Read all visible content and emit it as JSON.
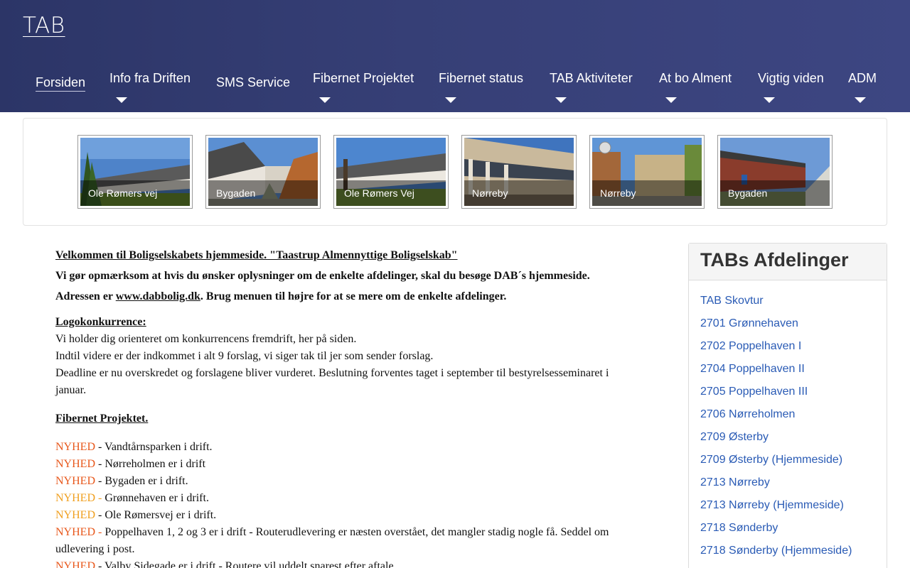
{
  "site": {
    "title": "TAB"
  },
  "nav": {
    "items": [
      {
        "label": "Forsiden",
        "active": true,
        "has_dropdown": false
      },
      {
        "label": "Info fra Driften",
        "has_dropdown": true
      },
      {
        "label": "SMS Service",
        "has_dropdown": false
      },
      {
        "label": "Fibernet Projektet",
        "has_dropdown": true
      },
      {
        "label": "Fibernet status",
        "has_dropdown": true
      },
      {
        "label": "TAB Aktiviteter",
        "has_dropdown": true
      },
      {
        "label": "At bo Alment",
        "has_dropdown": true
      },
      {
        "label": "Vigtig viden",
        "has_dropdown": true
      },
      {
        "label": "ADM",
        "has_dropdown": true
      }
    ]
  },
  "gallery": {
    "items": [
      {
        "caption": "Ole Rømers vej"
      },
      {
        "caption": "Bygaden"
      },
      {
        "caption": "Ole Rømers Vej"
      },
      {
        "caption": "Nørreby"
      },
      {
        "caption": "Nørreby"
      },
      {
        "caption": "Bygaden"
      }
    ]
  },
  "content": {
    "welcome": "Velkommen til Boligselskabets hjemmeside.  \"Taastrup Almennyttige Boligselskab\"",
    "notice_1": "Vi gør opmærksom at hvis du ønsker oplysninger om de enkelte afdelinger, skal du besøge DAB´s hjemmeside. Adressen er ",
    "notice_link": "www.dabbolig.dk",
    "notice_2": ". Brug menuen til højre for at se mere om de enkelte afdelinger.",
    "logo_heading": "Logokonkurrence:",
    "logo_p1": "Vi holder dig orienteret om konkurrencens fremdrift, her på siden.",
    "logo_p2": "Indtil videre er der indkommet i alt 9 forslag, vi siger tak til jer som sender forslag.",
    "logo_p3": "Deadline er nu overskredet og forslagene bliver vurderet. Beslutning forventes taget i september til bestyrelsesseminaret i januar.",
    "fiber_heading": "Fibernet Projektet.",
    "news": [
      {
        "tag": "NYHED",
        "text": " - Vandtårnsparken i drift."
      },
      {
        "tag": "NYHED",
        "text": " - Nørreholmen er i drift"
      },
      {
        "tag": "NYHED",
        "text": " - Bygaden er i drift."
      },
      {
        "tag": "NYHED - ",
        "text": "Grønnehaven er i drift."
      },
      {
        "tag": "NYHED",
        "text": " - Ole Rømersvej er i drift."
      },
      {
        "tag": "NYHED - ",
        "text": "Poppelhaven 1, 2 og 3 er i drift - Routerudlevering er næsten overstået, det mangler stadig nogle få. Seddel om udlevering i post."
      },
      {
        "tag": "NYHED",
        "text": " - Valby Sidegade er i drift - Routere vil uddelt snarest efter aftale."
      }
    ],
    "colors": {
      "nyhed_red": "#e8581c",
      "nyhed_orange": "#f0a020"
    }
  },
  "sidebar": {
    "title": "TABs Afdelinger",
    "items": [
      "TAB Skovtur",
      "2701 Grønnehaven",
      "2702 Poppelhaven I",
      "2704 Poppelhaven II",
      "2705 Poppelhaven III",
      "2706 Nørreholmen",
      "2709 Østerby",
      "2709 Østerby (Hjemmeside)",
      "2713 Nørreby",
      "2713 Nørreby (Hjemmeside)",
      "2718 Sønderby",
      "2718 Sønderby (Hjemmeside)"
    ]
  },
  "colors": {
    "header_bg": "#363f76",
    "link": "#2a5bb5"
  }
}
